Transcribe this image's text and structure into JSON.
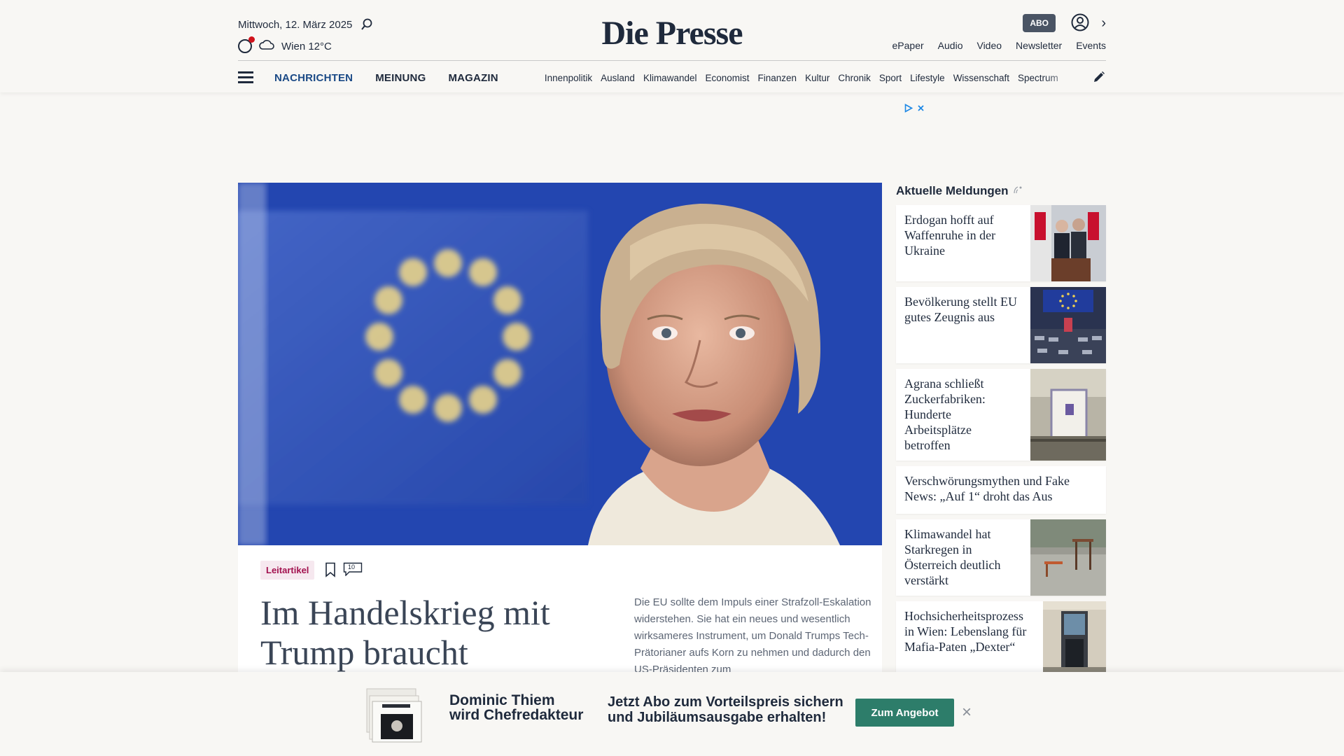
{
  "header": {
    "date": "Mittwoch, 12. März 2025",
    "weather": "Wien 12°C",
    "logo": "Die Presse",
    "abo_label": "ABO",
    "top_links": [
      "ePaper",
      "Audio",
      "Video",
      "Newsletter",
      "Events"
    ]
  },
  "nav": {
    "main": [
      "NACHRICHTEN",
      "MEINUNG",
      "MAGAZIN"
    ],
    "sub": [
      "Innenpolitik",
      "Ausland",
      "Klimawandel",
      "Economist",
      "Finanzen",
      "Kultur",
      "Chronik",
      "Sport",
      "Lifestyle",
      "Wissenschaft",
      "Spectrum"
    ]
  },
  "article": {
    "tag": "Leitartikel",
    "comment_count": "10",
    "headline": "Im Handelskrieg mit Trump braucht",
    "teaser": "Die EU sollte dem Impuls einer Strafzoll-Eskalation widerstehen. Sie hat ein neues und wesentlich wirksameres Instrument, um Donald Trumps Tech-Prätorianer aufs Korn zu nehmen und dadurch den US-Präsidenten zum"
  },
  "sidebar": {
    "title": "Aktuelle Meldungen",
    "items": [
      {
        "title": "Erdogan hofft auf Waffenruhe in der Ukraine"
      },
      {
        "title": "Bevölkerung stellt EU gutes Zeugnis aus"
      },
      {
        "title": "Agrana schließt Zuckerfabriken: Hunderte Arbeitsplätze betroffen"
      },
      {
        "title": "Verschwörungsmythen und Fake News: „Auf 1“ droht das Aus"
      },
      {
        "title": "Klimawandel hat Starkregen in Österreich deutlich verstärkt"
      },
      {
        "title": "Hochsicherheitsprozess in Wien: Lebenslang für Mafia-Paten „Dexter“"
      }
    ]
  },
  "promo": {
    "line1": "Dominic Thiem",
    "line2": "wird Chefredakteur",
    "offer1": "Jetzt Abo zum Vorteilspreis sichern",
    "offer2": "und Jubiläumsausgabe erhalten!",
    "button": "Zum Angebot",
    "close": "×"
  },
  "colors": {
    "brand_navy": "#1f2a3c",
    "nav_active": "#1b4a86",
    "tag_magenta": "#a3124f",
    "cta_green": "#2d7d6a",
    "abo_gray": "#4a5464"
  }
}
